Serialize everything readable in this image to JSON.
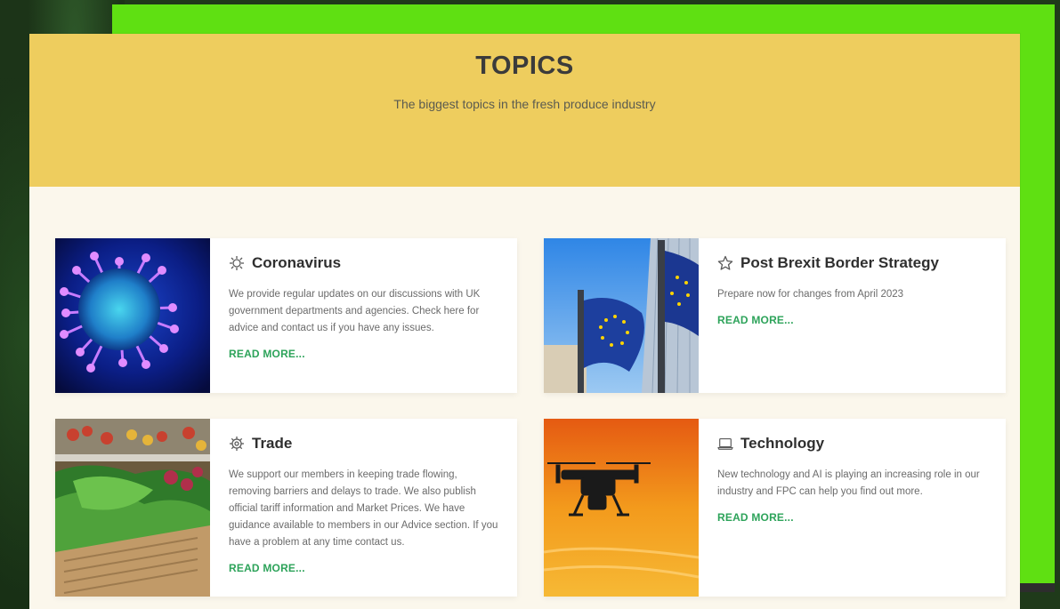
{
  "topics": {
    "title": "TOPICS",
    "subtitle": "The biggest topics in the fresh produce industry"
  },
  "cards": [
    {
      "title": "Coronavirus",
      "icon": "virus-icon",
      "text": "We provide regular updates on our discussions with UK government departments and agencies. Check here for advice and contact us if you have any issues.",
      "link": "READ MORE..."
    },
    {
      "title": "Post Brexit Border Strategy",
      "icon": "star-icon",
      "text": "Prepare now for changes from April 2023",
      "link": "READ MORE..."
    },
    {
      "title": "Trade",
      "icon": "gear-icon",
      "text": "We support our members in keeping trade flowing, removing barriers and delays to trade. We also publish official tariff information and Market Prices. We have guidance available to members in our Advice section. If you have a problem at any time contact us.",
      "link": "READ MORE..."
    },
    {
      "title": "Technology",
      "icon": "laptop-icon",
      "text": "New technology and AI is playing an increasing role in our industry and FPC can help you find out more.",
      "link": "READ MORE..."
    }
  ],
  "colors": {
    "header_yellow": "#eecd5e",
    "accent_green": "#2da35a",
    "slab_green": "#5fe012"
  }
}
